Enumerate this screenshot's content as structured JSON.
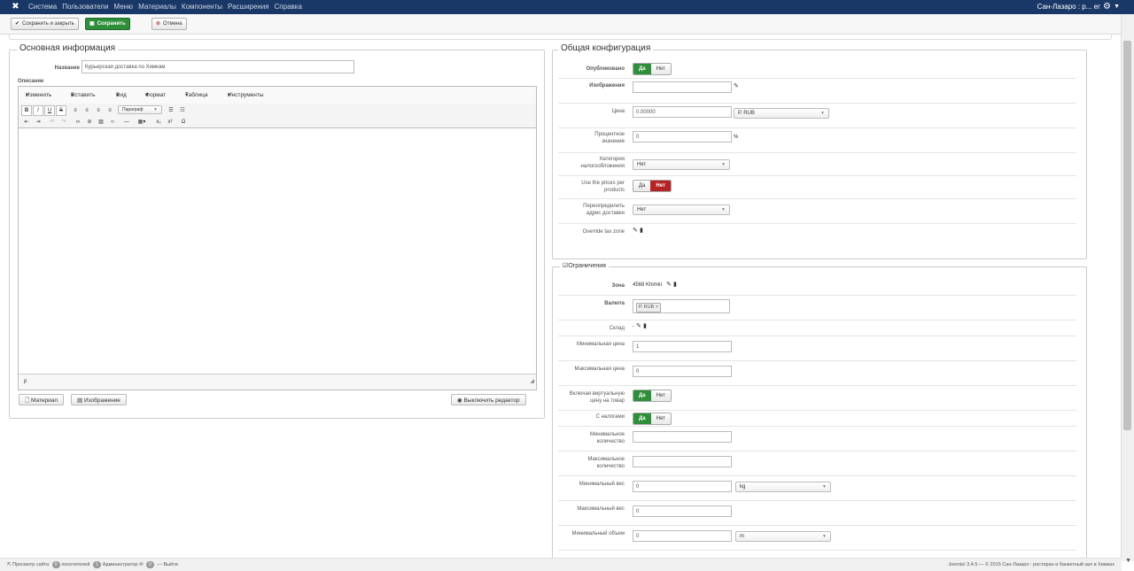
{
  "navbar": {
    "menu": [
      "Система",
      "Пользователи",
      "Меню",
      "Материалы",
      "Компоненты",
      "Расширения",
      "Справка"
    ],
    "site_name": "Сан-Лазаро : р... ег"
  },
  "toolbar": {
    "save_close_label": "Сохранить и закрыть",
    "save_label": "Сохранить",
    "cancel_label": "Отмена"
  },
  "main_info": {
    "legend": "Основная информация",
    "name_label": "Название",
    "name_value": "Курьерская доставка по Химкам",
    "description_label": "Описание",
    "editor_menu": [
      "Изменить",
      "Вставить",
      "Вид",
      "Формат",
      "Таблица",
      "Инструменты"
    ],
    "paragraph_select": "Параграф",
    "path_text": "p",
    "btn_article": "Материал",
    "btn_image": "Изображение",
    "btn_toggle_editor": "Выключить редактор"
  },
  "general_config": {
    "legend": "Общая конфигурация",
    "published_label": "Опубликовано",
    "yes": "Да",
    "no": "Нет",
    "images_label": "Изображения",
    "price_label": "Цена",
    "price_value": "0.00000",
    "currency_value": "Р. RUB",
    "percent_label": "Процентное значение",
    "percent_value": "0",
    "percent_unit": "%",
    "tax_category_label": "Категория налогообложения",
    "tax_category_value": "Нет",
    "use_prices_label": "Use the prices per products",
    "override_address_label": "Переопределить адрес доставки",
    "override_address_value": "Нет",
    "override_tax_label": "Override tax zone"
  },
  "restrictions": {
    "legend": "Ограничения",
    "zone_label": "Зона",
    "zone_value": "4568 Khimki",
    "currency_label": "Валюта",
    "currency_tag": "Р. RUB",
    "warehouse_label": "Склад",
    "warehouse_value": "-",
    "min_price_label": "Минимальная цена",
    "min_price_value": "1",
    "max_price_label": "Максимальная цена",
    "max_price_value": "0",
    "virtual_price_label": "Включая виртуальную цену на товар",
    "with_tax_label": "С налогами",
    "min_qty_label": "Минимальное количество",
    "max_qty_label": "Максимальное количество",
    "min_weight_label": "Минимальный вес",
    "min_weight_value": "0",
    "weight_unit": "kg",
    "max_weight_label": "Максимальный вес",
    "max_weight_value": "0",
    "min_volume_label": "Минимальный объем",
    "min_volume_value": "0",
    "volume_unit": "m"
  },
  "statusbar": {
    "view_site": "Просмотр сайта",
    "visitors_count": "0",
    "visitors_label": "посетителей",
    "admins_count": "1",
    "admins_label": "Администратор",
    "messages_count": "0",
    "logout": "Выйти",
    "footer": "Joomla! 3.4.5  —  © 2015 Сан-Лазаро : ресторан и банкетный зал в Химках"
  }
}
